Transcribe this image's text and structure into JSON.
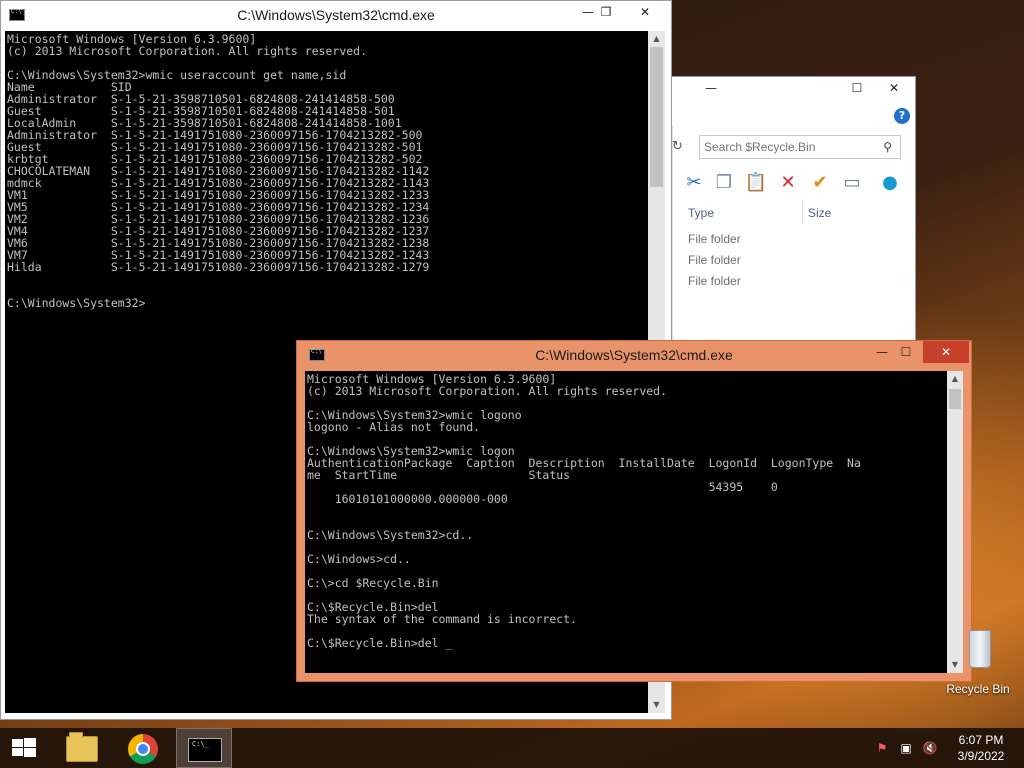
{
  "window_console_main": {
    "title": "C:\\Windows\\System32\\cmd.exe",
    "controls": {
      "minimize": "—",
      "maximize": "❐",
      "close": "✕"
    },
    "lines": [
      "Microsoft Windows [Version 6.3.9600]",
      "(c) 2013 Microsoft Corporation. All rights reserved.",
      "",
      "C:\\Windows\\System32>wmic useraccount get name,sid",
      "Name           SID",
      "Administrator  S-1-5-21-3598710501-6824808-241414858-500",
      "Guest          S-1-5-21-3598710501-6824808-241414858-501",
      "LocalAdmin     S-1-5-21-3598710501-6824808-241414858-1001",
      "Administrator  S-1-5-21-1491751080-2360097156-1704213282-500",
      "Guest          S-1-5-21-1491751080-2360097156-1704213282-501",
      "krbtgt         S-1-5-21-1491751080-2360097156-1704213282-502",
      "CHOCOLATEMAN   S-1-5-21-1491751080-2360097156-1704213282-1142",
      "mdmck          S-1-5-21-1491751080-2360097156-1704213282-1143",
      "VM1            S-1-5-21-1491751080-2360097156-1704213282-1233",
      "VM5            S-1-5-21-1491751080-2360097156-1704213282-1234",
      "VM2            S-1-5-21-1491751080-2360097156-1704213282-1236",
      "VM4            S-1-5-21-1491751080-2360097156-1704213282-1237",
      "VM6            S-1-5-21-1491751080-2360097156-1704213282-1238",
      "VM7            S-1-5-21-1491751080-2360097156-1704213282-1243",
      "Hilda          S-1-5-21-1491751080-2360097156-1704213282-1279",
      "",
      "",
      "C:\\Windows\\System32>"
    ]
  },
  "explorer": {
    "controls": {
      "minimize": "—",
      "maximize": "☐",
      "close": "✕"
    },
    "help": "?",
    "search_placeholder": "Search $Recycle.Bin",
    "search_icon": "magnifier",
    "toolbar_icons": [
      "cut-icon",
      "copy-icon",
      "paste-icon",
      "delete-icon",
      "properties-check-icon",
      "rename-icon",
      "shell-icon"
    ],
    "columns": {
      "type": "Type",
      "size": "Size"
    },
    "rows": [
      "File folder",
      "File folder",
      "File folder"
    ]
  },
  "window_console_front": {
    "title": "C:\\Windows\\System32\\cmd.exe",
    "controls": {
      "minimize": "—",
      "maximize": "☐",
      "close": "✕"
    },
    "lines": [
      "Microsoft Windows [Version 6.3.9600]",
      "(c) 2013 Microsoft Corporation. All rights reserved.",
      "",
      "C:\\Windows\\System32>wmic logono",
      "logono - Alias not found.",
      "",
      "C:\\Windows\\System32>wmic logon",
      "AuthenticationPackage  Caption  Description  InstallDate  LogonId  LogonType  Na",
      "me  StartTime                   Status",
      "                                                          54395    0",
      "    16010101000000.000000-000",
      "",
      "",
      "C:\\Windows\\System32>cd..",
      "",
      "C:\\Windows>cd..",
      "",
      "C:\\>cd $Recycle.Bin",
      "",
      "C:\\$Recycle.Bin>del",
      "The syntax of the command is incorrect.",
      "",
      "C:\\$Recycle.Bin>del _"
    ]
  },
  "desktop": {
    "recycle_bin_label": "Recycle Bin"
  },
  "taskbar": {
    "pinned": [
      "file-explorer",
      "chrome",
      "command-prompt"
    ],
    "active": "command-prompt",
    "clock": {
      "time": "6:07 PM",
      "date": "3/9/2022"
    }
  },
  "colors": {
    "front_window_frame": "#e8936a",
    "console_bg": "#000000",
    "console_fg": "#c0c0c0"
  }
}
